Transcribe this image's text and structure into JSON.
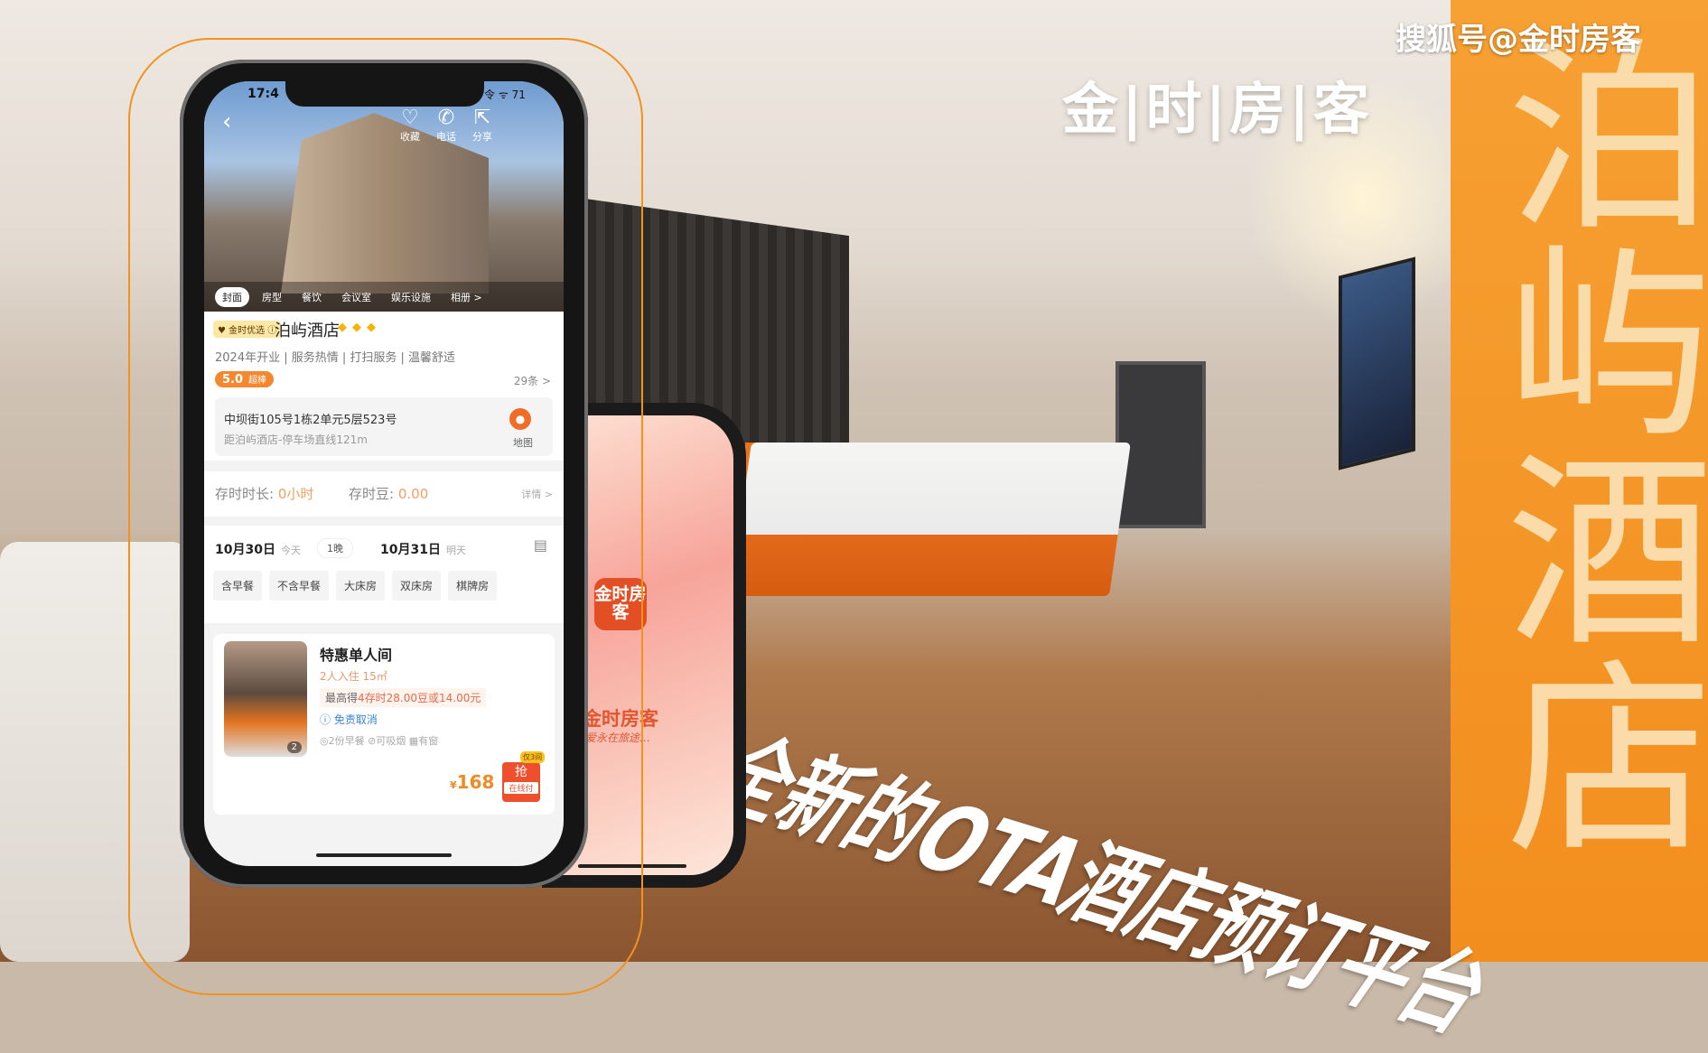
{
  "watermark": "搜狐号@金时房客",
  "brand": "金|时|房|客",
  "vertical_title": "泊屿酒店",
  "slogan": "全新的OTA酒店预订平台",
  "colors": {
    "accent": "#f28e1e",
    "brand_red": "#e34f24"
  },
  "phone_app": {
    "status_time": "17:4",
    "status_icons": "令 ᯤ 71",
    "header_actions": [
      {
        "icon": "heart-icon",
        "glyph": "♡",
        "label": "收藏"
      },
      {
        "icon": "phone-icon",
        "glyph": "✆",
        "label": "电话"
      },
      {
        "icon": "share-icon",
        "glyph": "⇱",
        "label": "分享"
      }
    ],
    "gallery_tabs": [
      "封面",
      "房型",
      "餐饮",
      "会议室",
      "娱乐设施",
      "相册 >"
    ],
    "badge": "♥ 金时优选 ⓘ",
    "hotel_name": "泊屿酒店",
    "stars": "◆◆◆",
    "tags": "2024年开业 | 服务热情 | 打扫服务 | 温馨舒适",
    "score": "5.0",
    "score_label": "超棒",
    "review_count": "29条 >",
    "address": "中坝街105号1栋2单元5层523号",
    "distance": "距泊屿酒店-停车场直线121m",
    "map_label": "地图",
    "store_duration_label": "存时时长:",
    "store_duration_value": "0小时",
    "store_beans_label": "存时豆:",
    "store_beans_value": "0.00",
    "details": "详情 >",
    "checkin_date": "10月30日",
    "checkin_day": "今天",
    "nights": "1晚",
    "checkout_date": "10月31日",
    "checkout_day": "明天",
    "filters": [
      "含早餐",
      "不含早餐",
      "大床房",
      "双床房",
      "棋牌房"
    ],
    "room": {
      "name": "特惠单人间",
      "image_count": "2",
      "occupancy": "2人入住 15㎡",
      "reward_prefix": "最高得",
      "reward_highlight": "4存时28.00豆或14.00元",
      "cancel": "ⓘ 免责取消",
      "features": "◎2份早餐  ⊘可吸烟  ▦有窗",
      "currency": "¥",
      "price": "168",
      "grab": "抢",
      "pay": "在线付",
      "limit": "仅3间"
    }
  },
  "splash_app": {
    "logo": "金时房客",
    "name": "金时房客",
    "tagline": "爱永在旅途…"
  }
}
